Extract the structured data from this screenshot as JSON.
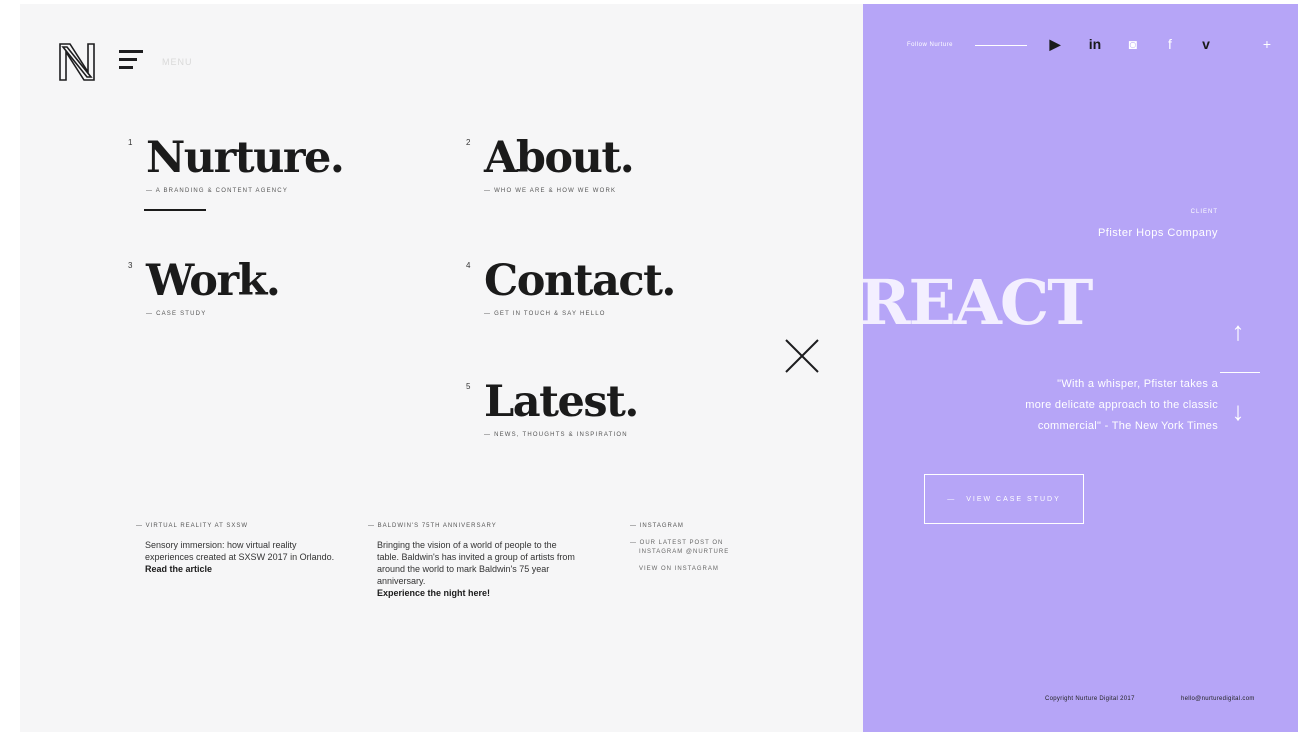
{
  "header": {
    "menu_label": "MENU"
  },
  "nav": {
    "items": [
      {
        "num": "1",
        "title": "Nurture.",
        "subtitle": "— A branding & content agency"
      },
      {
        "num": "2",
        "title": "About.",
        "subtitle": "— Who we are & how we work"
      },
      {
        "num": "3",
        "title": "Work.",
        "subtitle": "— Case study"
      },
      {
        "num": "4",
        "title": "Contact.",
        "subtitle": "— Get in touch & say hello"
      },
      {
        "num": "5",
        "title": "Latest.",
        "subtitle": "— News, thoughts & inspiration"
      }
    ]
  },
  "news": [
    {
      "tag": "— Virtual reality at SXSW",
      "body": "Sensory immersion: how virtual reality experiences created at SXSW 2017 in Orlando.",
      "link": "Read the article"
    },
    {
      "tag": "— Baldwin's 75th anniversary",
      "body": "Bringing the vision of a world of people to the table. Baldwin's has invited a group of artists from around the world to mark Baldwin's 75 year anniversary.",
      "link": "Experience the night here!"
    },
    {
      "tag": "— Instagram",
      "meta": [
        "— Our latest post on",
        "instagram @nurture"
      ],
      "meta2": "View on instagram"
    }
  ],
  "side": {
    "follow_label": "Follow Nurture",
    "social": [
      "youtube-icon",
      "linkedin-icon",
      "instagram-icon",
      "facebook-icon",
      "vimeo-icon",
      "plus-icon"
    ],
    "eyebrow": "CLIENT",
    "client": "Pfister Hops Company",
    "project": "REACT",
    "quote": [
      "\"With a whisper, Pfister takes a",
      "more delicate approach to the classic",
      "commercial\" - The New York Times"
    ],
    "view_button": "VIEW CASE STUDY",
    "arrow_up": "↑",
    "arrow_down": "↓",
    "footer_left": "Copyright Nurture Digital 2017",
    "footer_right": "hello@nurturedigital.com"
  },
  "colors": {
    "accent": "#b6a5f7",
    "panel": "#f6f6f7",
    "text": "#1b1b1b"
  }
}
